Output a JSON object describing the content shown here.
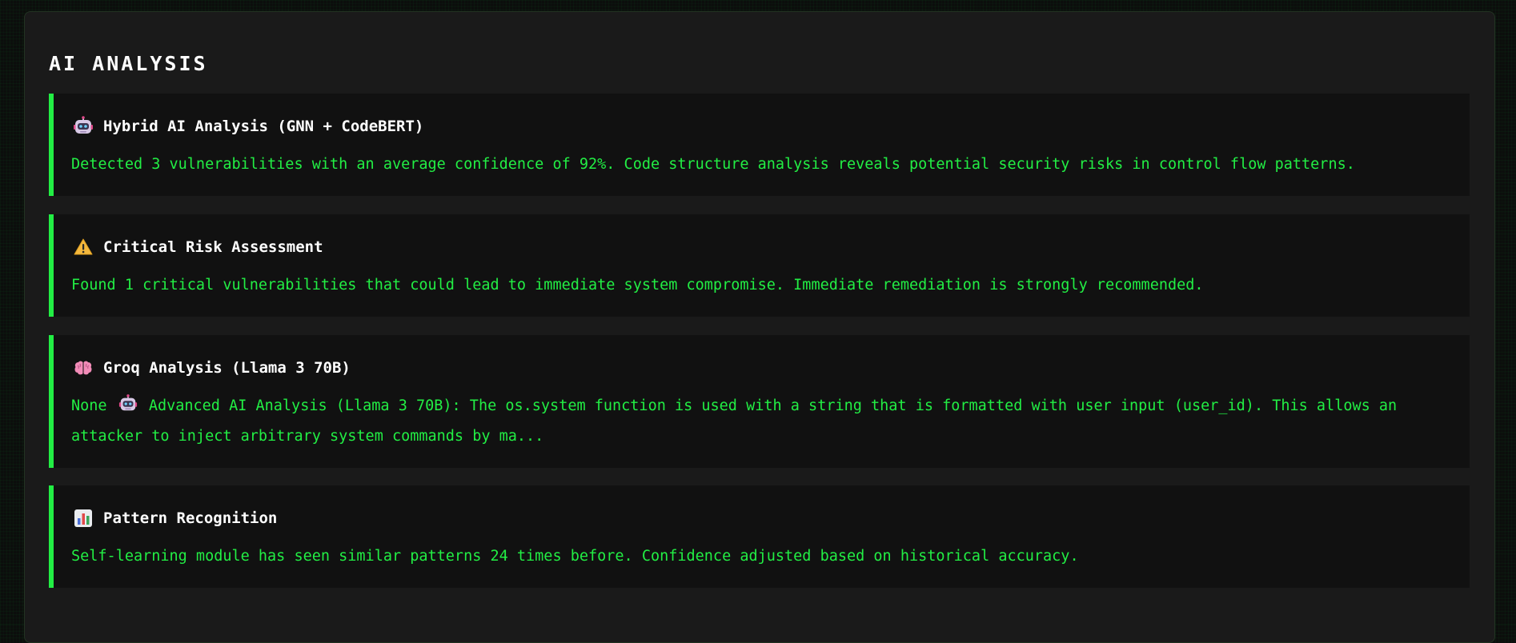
{
  "panel": {
    "title": "AI ANALYSIS"
  },
  "cards": [
    {
      "icon": "robot-icon",
      "title": "Hybrid AI Analysis (GNN + CodeBERT)",
      "text": "Detected 3 vulnerabilities with an average confidence of 92%. Code structure analysis reveals potential security risks in control flow patterns."
    },
    {
      "icon": "warning-icon",
      "title": "Critical Risk Assessment",
      "text": "Found 1 critical vulnerabilities that could lead to immediate system compromise. Immediate remediation is strongly recommended."
    },
    {
      "icon": "brain-icon",
      "title": "Groq Analysis (Llama 3 70B)",
      "text_prefix": "None",
      "text_icon": "robot-icon",
      "text": "Advanced AI Analysis (Llama 3 70B): The os.system function is used with a string that is formatted with user input (user_id). This allows an attacker to inject arbitrary system commands by ma..."
    },
    {
      "icon": "bar-chart-icon",
      "title": "Pattern Recognition",
      "text": "Self-learning module has seen similar patterns 24 times before. Confidence adjusted based on historical accuracy."
    }
  ],
  "colors": {
    "accent": "#22ee44",
    "panel_bg": "#1a1a1a",
    "card_bg": "#111111",
    "page_bg": "#0c0d0c"
  }
}
